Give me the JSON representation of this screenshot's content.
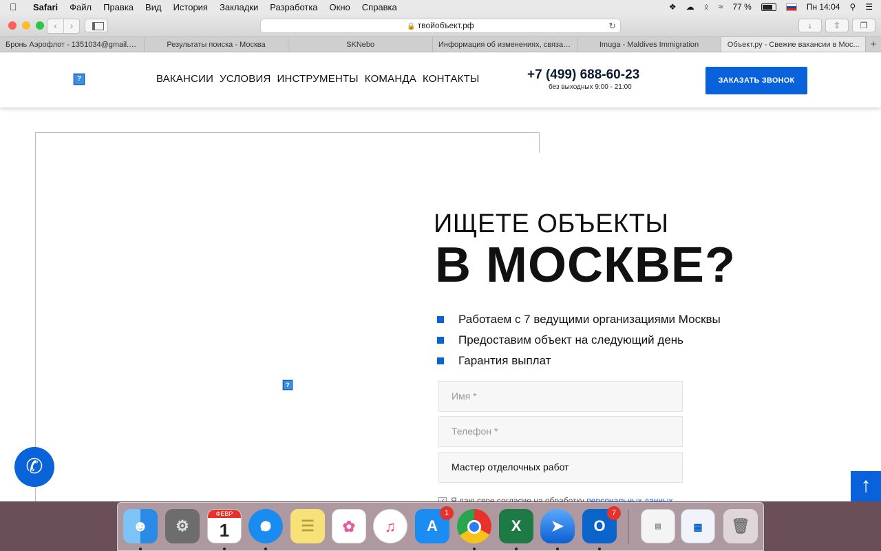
{
  "menubar": {
    "app": "Safari",
    "items": [
      "Файл",
      "Правка",
      "Вид",
      "История",
      "Закладки",
      "Разработка",
      "Окно",
      "Справка"
    ],
    "battery": "77 %",
    "clock": "Пн 14:04"
  },
  "browser": {
    "url": "твойобъект.рф",
    "tabs": [
      "Бронь Аэрофлот - 1351034@gmail.c...",
      "Результаты поиска - Москва",
      "SKNebo",
      "Информация об изменениях, связан...",
      "Imuga - Maldives Immigration",
      "Объект.ру - Свежие вакансии в Мос..."
    ],
    "active_tab": 5
  },
  "site": {
    "nav": [
      "ВАКАНСИИ",
      "УСЛОВИЯ",
      "ИНСТРУМЕНТЫ",
      "КОМАНДА",
      "КОНТАКТЫ"
    ],
    "phone": "+7 (499) 688-60-23",
    "hours": "без выходных 9:00 - 21:00",
    "callback_button": "ЗАКАЗАТЬ ЗВОНОК",
    "headline_line1": "ИЩЕТЕ ОБЪЕКТЫ",
    "headline_line2": "В МОСКВЕ?",
    "bullets": [
      "Работаем с 7 ведущими организациями Москвы",
      "Предоставим объект на следующий день",
      "Гарантия выплат"
    ],
    "form": {
      "name_placeholder": "Имя *",
      "phone_placeholder": "Телефон *",
      "profession_value": "Мастер отделочных работ",
      "consent_text": "Я даю свое согласие на обработку",
      "consent_link": "персональных данных"
    },
    "accent_color": "#0961dc"
  },
  "dock": {
    "calendar_month": "ФЕВР",
    "calendar_day": "1",
    "appstore_badge": "1",
    "outlook_badge": "7",
    "excel_letter": "X",
    "outlook_letter": "O"
  }
}
